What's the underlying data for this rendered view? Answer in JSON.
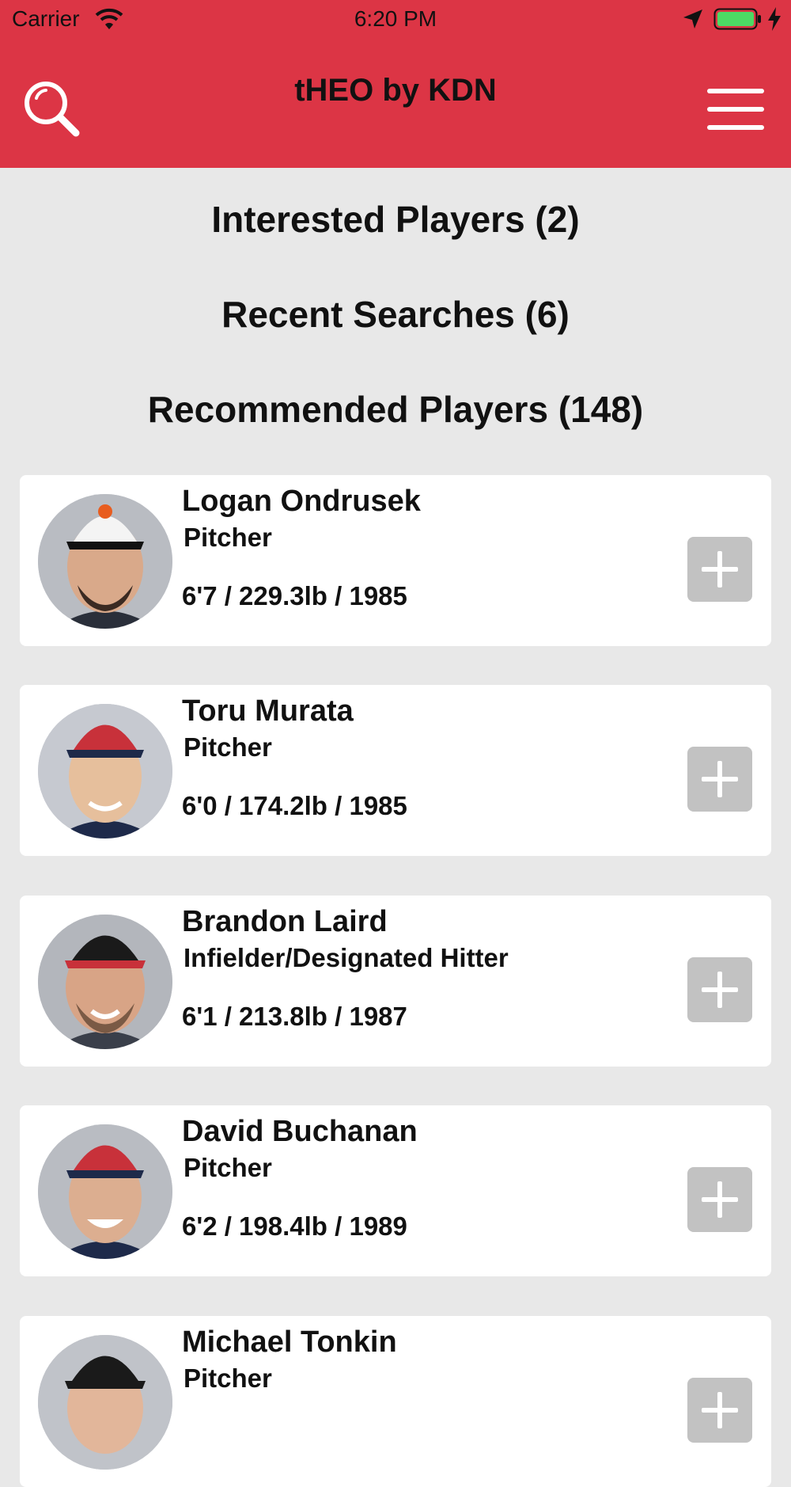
{
  "status_bar": {
    "carrier": "Carrier",
    "time": "6:20 PM"
  },
  "header": {
    "title": "tHEO by KDN",
    "search_icon": "search-icon",
    "menu_icon": "menu-icon",
    "background_color": "#dc3545"
  },
  "sections": {
    "interested": "Interested Players (2)",
    "recent": "Recent Searches (6)",
    "recommended": "Recommended Players (148)"
  },
  "players": [
    {
      "name": "Logan Ondrusek",
      "position": "Pitcher",
      "stats": "6'7 / 229.3lb / 1985",
      "cap_color": "#f4f4f4",
      "brim_color": "#111111"
    },
    {
      "name": "Toru Murata",
      "position": "Pitcher",
      "stats": "6'0 / 174.2lb / 1985",
      "cap_color": "#c8313a",
      "brim_color": "#1e2a4a"
    },
    {
      "name": "Brandon Laird",
      "position": "Infielder/Designated Hitter",
      "stats": "6'1 / 213.8lb / 1987",
      "cap_color": "#1a1a1a",
      "brim_color": "#c8313a"
    },
    {
      "name": "David Buchanan",
      "position": "Pitcher",
      "stats": "6'2 / 198.4lb / 1989",
      "cap_color": "#c8313a",
      "brim_color": "#1e2a4a"
    },
    {
      "name": "Michael Tonkin",
      "position": "Pitcher",
      "stats": "",
      "cap_color": "#1a1a1a",
      "brim_color": "#1a1a1a"
    }
  ]
}
